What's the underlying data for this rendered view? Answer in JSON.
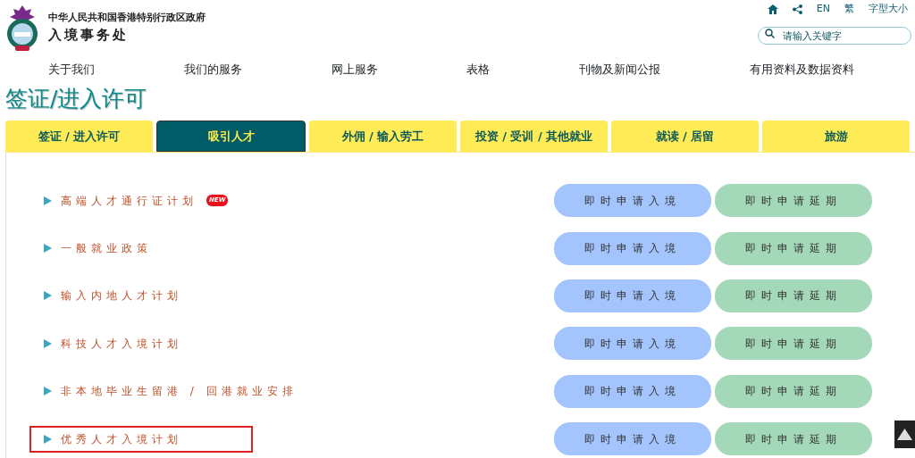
{
  "header": {
    "government": "中华人民共和国香港特别行政区政府",
    "department": "入境事务处"
  },
  "utility_links": [
    {
      "kind": "home"
    },
    {
      "kind": "share"
    },
    {
      "kind": "text",
      "label": "EN"
    },
    {
      "kind": "text",
      "label": "繁"
    },
    {
      "kind": "text",
      "label": "字型大小"
    }
  ],
  "search": {
    "placeholder": "请输入关键字"
  },
  "main_nav": [
    "关于我们",
    "我们的服务",
    "网上服务",
    "表格",
    "刊物及新闻公报",
    "有用资料及数据资料"
  ],
  "page_title": "签证/进入许可",
  "tabs": [
    {
      "label": "签证 / 进入许可",
      "selected": false
    },
    {
      "label": "吸引人才",
      "selected": true
    },
    {
      "label": "外佣 / 输入劳工",
      "selected": false
    },
    {
      "label": "投资 / 受训 / 其他就业",
      "selected": false
    },
    {
      "label": "就读 / 居留",
      "selected": false
    },
    {
      "label": "旅游",
      "selected": false
    }
  ],
  "schemes": [
    {
      "name": "高端人才通行证计划",
      "badge": "NEW",
      "highlighted": false,
      "entry_button": "即时申请入境",
      "extension_button": "即时申请延期"
    },
    {
      "name": "一般就业政策",
      "highlighted": false,
      "entry_button": "即时申请入境",
      "extension_button": "即时申请延期"
    },
    {
      "name": "输入内地人才计划",
      "highlighted": false,
      "entry_button": "即时申请入境",
      "extension_button": "即时申请延期"
    },
    {
      "name": "科技人才入境计划",
      "highlighted": false,
      "entry_button": "即时申请入境",
      "extension_button": "即时申请延期"
    },
    {
      "name": "非本地毕业生留港 / 回港就业安排",
      "highlighted": false,
      "entry_button": "即时申请入境",
      "extension_button": "即时申请延期"
    },
    {
      "name": "优秀人才入境计划",
      "highlighted": true,
      "entry_button": "即时申请入境",
      "extension_button": "即时申请延期"
    }
  ]
}
